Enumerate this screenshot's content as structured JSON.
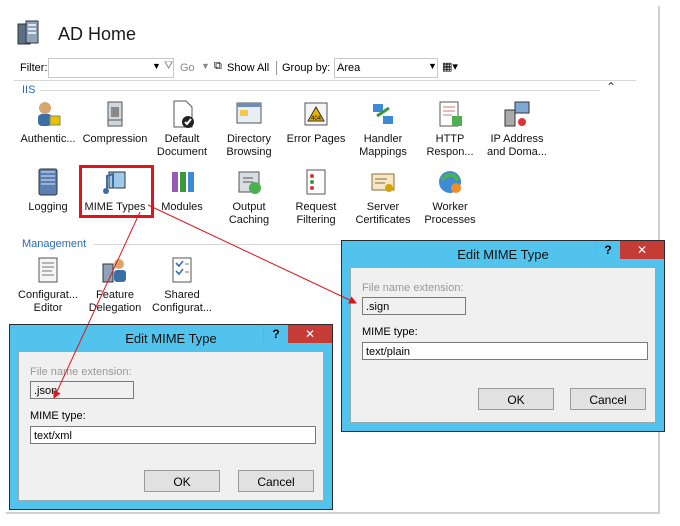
{
  "header": {
    "title": "AD Home"
  },
  "toolbar": {
    "filter_label": "Filter:",
    "go_label": "Go",
    "show_all_label": "Show All",
    "group_by_label": "Group by:",
    "group_by_value": "Area"
  },
  "sections": {
    "iis": "IIS",
    "management": "Management"
  },
  "iis_features": [
    {
      "line1": "Authentic...",
      "line2": ""
    },
    {
      "line1": "Compression",
      "line2": ""
    },
    {
      "line1": "Default",
      "line2": "Document"
    },
    {
      "line1": "Directory",
      "line2": "Browsing"
    },
    {
      "line1": "Error Pages",
      "line2": ""
    },
    {
      "line1": "Handler",
      "line2": "Mappings"
    },
    {
      "line1": "HTTP",
      "line2": "Respon..."
    },
    {
      "line1": "IP Address",
      "line2": "and Doma..."
    },
    {
      "line1": "Logging",
      "line2": ""
    },
    {
      "line1": "MIME Types",
      "line2": ""
    },
    {
      "line1": "Modules",
      "line2": ""
    },
    {
      "line1": "Output",
      "line2": "Caching"
    },
    {
      "line1": "Request",
      "line2": "Filtering"
    },
    {
      "line1": "Server",
      "line2": "Certificates"
    },
    {
      "line1": "Worker",
      "line2": "Processes"
    }
  ],
  "mgmt_features": [
    {
      "line1": "Configurat...",
      "line2": "Editor"
    },
    {
      "line1": "Feature",
      "line2": "Delegation"
    },
    {
      "line1": "Shared",
      "line2": "Configurat..."
    }
  ],
  "dialog_left": {
    "title": "Edit MIME Type",
    "help": "?",
    "close": "✕",
    "ext_label": "File name extension:",
    "ext_value": ".json",
    "type_label": "MIME type:",
    "type_value": "text/xml",
    "ok": "OK",
    "cancel": "Cancel"
  },
  "dialog_right": {
    "title": "Edit MIME Type",
    "help": "?",
    "close": "✕",
    "ext_label": "File name extension:",
    "ext_value": ".sign",
    "type_label": "MIME type:",
    "type_value": "text/plain",
    "ok": "OK",
    "cancel": "Cancel"
  },
  "colors": {
    "dialog_frame": "#52c3ec",
    "highlight": "#e0141b",
    "close_button": "#c43c35",
    "section_header": "#2a6ab3"
  }
}
